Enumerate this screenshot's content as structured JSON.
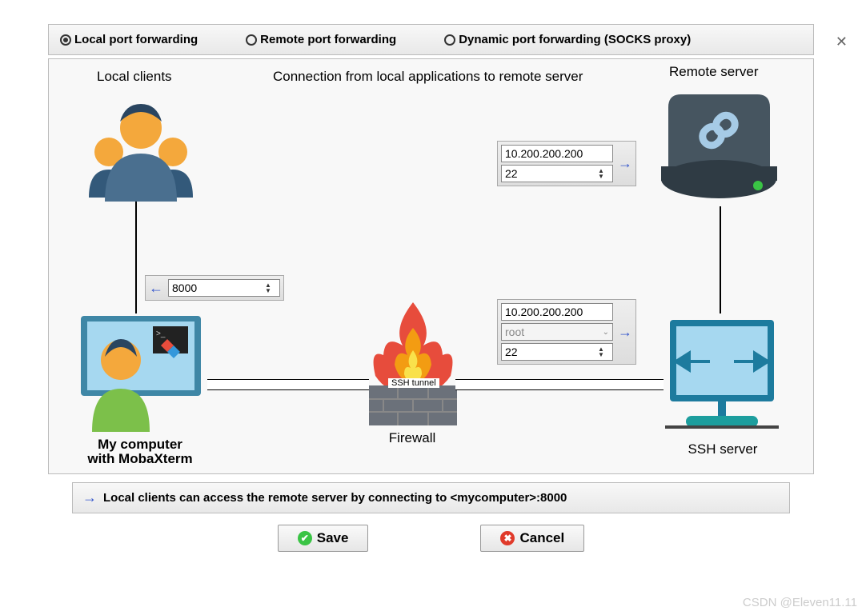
{
  "tabs": {
    "local": "Local port forwarding",
    "remote": "Remote port forwarding",
    "dynamic": "Dynamic port forwarding (SOCKS proxy)",
    "selected": "local"
  },
  "labels": {
    "local_clients": "Local clients",
    "connection_title": "Connection from local applications to remote server",
    "remote_server": "Remote server",
    "my_computer_l1": "My computer",
    "my_computer_l2": "with MobaXterm",
    "firewall": "Firewall",
    "ssh_server": "SSH server",
    "ssh_tunnel": "SSH tunnel"
  },
  "local": {
    "port": "8000"
  },
  "remote": {
    "host": "10.200.200.200",
    "port": "22"
  },
  "sshserver": {
    "host": "10.200.200.200",
    "user": "root",
    "port": "22"
  },
  "hint": "Local clients can access the remote server by connecting to <mycomputer>:8000",
  "buttons": {
    "save": "Save",
    "cancel": "Cancel"
  },
  "watermark": "CSDN @Eleven11.11"
}
